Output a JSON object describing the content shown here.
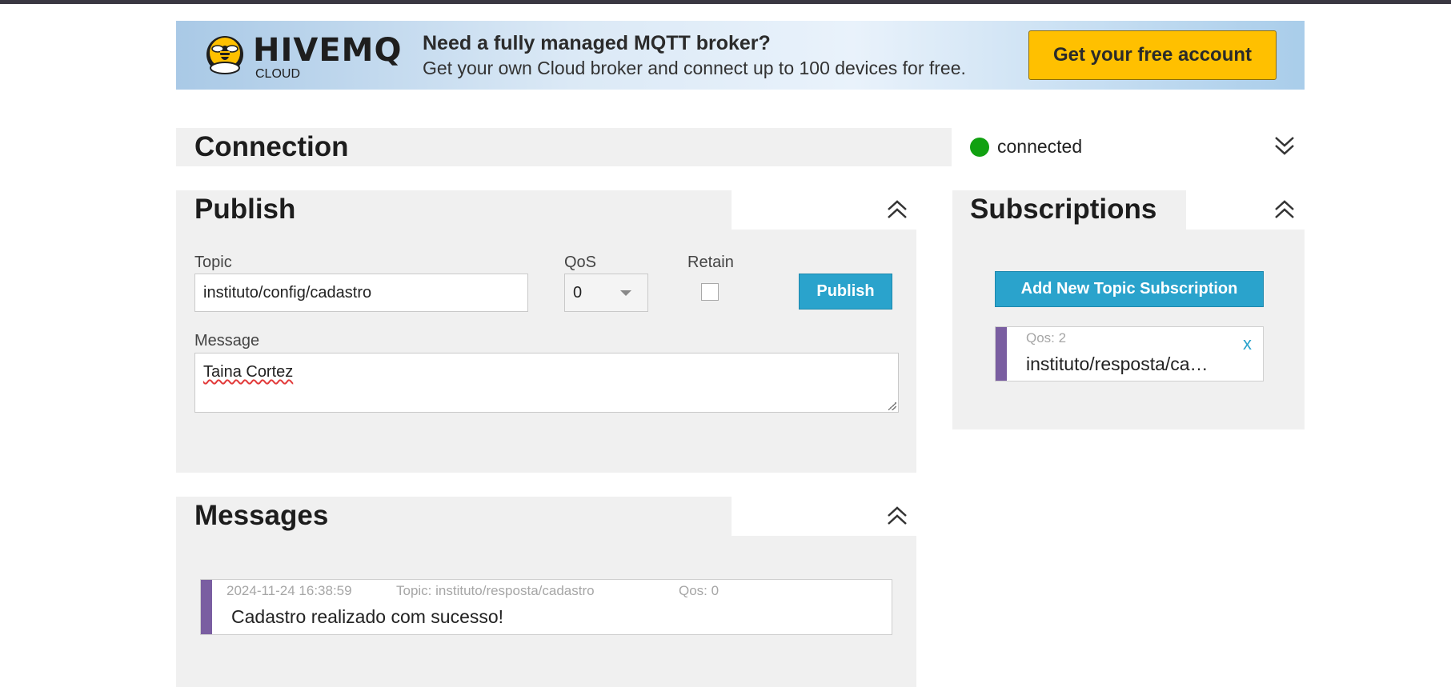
{
  "banner": {
    "logo_word": "HIVEMQ",
    "logo_sub": "CLOUD",
    "headline": "Need a fully managed MQTT broker?",
    "subline": "Get your own Cloud broker and connect up to 100 devices for free.",
    "cta_label": "Get your free account",
    "cta_color": "#ffc000"
  },
  "connection": {
    "title": "Connection",
    "status": "connected",
    "status_color": "#11a111"
  },
  "publish": {
    "title": "Publish",
    "topic_label": "Topic",
    "topic_value": "instituto/config/cadastro",
    "qos_label": "QoS",
    "qos_value": "0",
    "retain_label": "Retain",
    "retain_checked": false,
    "button_label": "Publish",
    "message_label": "Message",
    "message_value": "Taina Cortez"
  },
  "subscriptions": {
    "title": "Subscriptions",
    "add_label": "Add New Topic Subscription",
    "items": [
      {
        "qos": "Qos: 2",
        "topic": "instituto/resposta/ca…",
        "color": "#7a5ea1",
        "remove": "x"
      }
    ]
  },
  "messages": {
    "title": "Messages",
    "items": [
      {
        "timestamp": "2024-11-24 16:38:59",
        "topic": "Topic: instituto/resposta/cadastro",
        "qos": "Qos: 0",
        "payload": "Cadastro realizado com sucesso!",
        "color": "#7a5ea1"
      }
    ]
  },
  "icons": {
    "collapse": "chevron-double-up-icon",
    "expand": "chevron-double-down-icon",
    "dropdown": "caret-down-icon"
  }
}
